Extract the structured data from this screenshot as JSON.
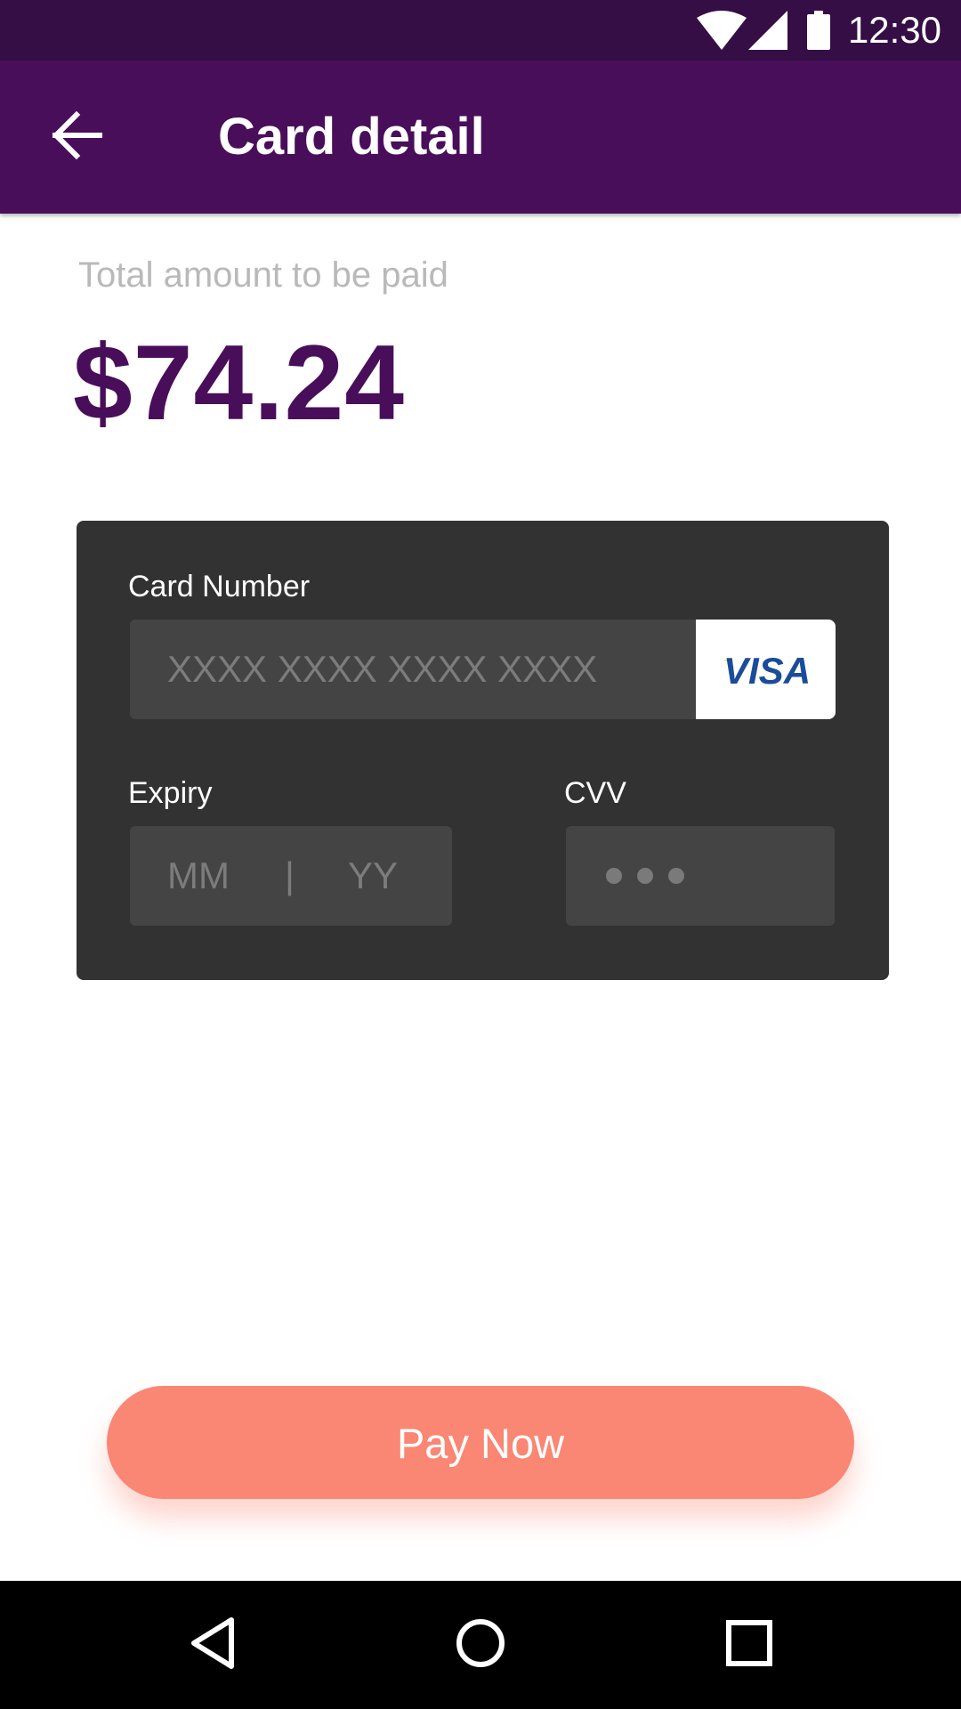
{
  "status_bar": {
    "time": "12:30",
    "icons": [
      "wifi-icon",
      "cell-signal-icon",
      "battery-icon"
    ]
  },
  "app_bar": {
    "title": "Card detail",
    "back_icon": "arrow-back-icon"
  },
  "payment": {
    "amount_label": "Total amount to be paid",
    "amount": "$74.24"
  },
  "card_form": {
    "card_number_label": "Card Number",
    "card_number_placeholder": "XXXX XXXX XXXX XXXX",
    "card_brand": "VISA",
    "expiry_label": "Expiry",
    "expiry_month_placeholder": "MM",
    "expiry_separator": "|",
    "expiry_year_placeholder": "YY",
    "cvv_label": "CVV"
  },
  "actions": {
    "pay_label": "Pay Now"
  },
  "nav_bar": {
    "icons": [
      "nav-back-icon",
      "nav-home-icon",
      "nav-recents-icon"
    ]
  },
  "colors": {
    "status_bar": "#360e46",
    "app_bar": "#490e5a",
    "amount": "#490e5a",
    "card_panel": "#323232",
    "input": "#444444",
    "pay_button": "#fa8674",
    "visa_blue": "#1a4c9a",
    "visa_gold": "#f2a900"
  }
}
